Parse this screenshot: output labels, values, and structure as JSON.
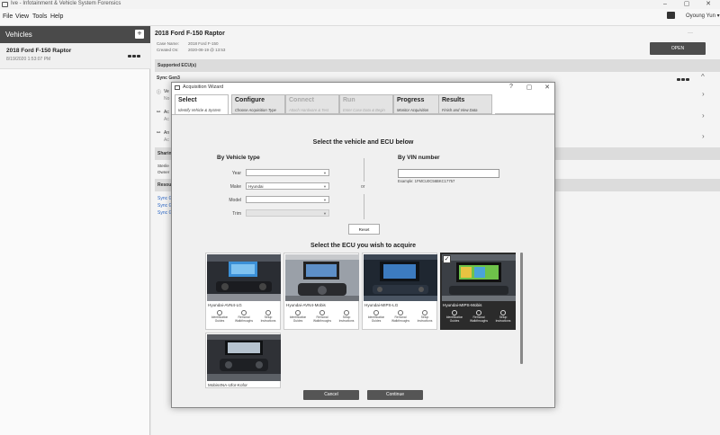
{
  "window": {
    "title": "Ive - Infotainment & Vehicle System Forensics",
    "controls": [
      "–",
      "▢",
      "✕"
    ]
  },
  "menu": {
    "items": [
      "File",
      "View",
      "Tools",
      "Help"
    ],
    "user": "Oyoung Yun ▾"
  },
  "sidebar": {
    "title": "Vehicles",
    "add_label": "+",
    "vehicle": {
      "name": "2018 Ford F-150 Raptor",
      "date": "8/19/2020 1:53:07 PM"
    }
  },
  "case": {
    "title": "2018 Ford F-150 Raptor",
    "name_label": "Case Name:",
    "name_value": "2018 Ford F-150",
    "created_label": "Created On:",
    "created_value": "2020-08-19 @ 13:53",
    "open_label": "OPEN",
    "more_label": "···",
    "supported_label": "Supported ECU(s)",
    "sync_label": "Sync Gen3",
    "rows": [
      {
        "icon": "ⓘ",
        "title": "Ve",
        "sub": "No"
      },
      {
        "icon": "⚯",
        "title": "Ac",
        "sub": "Ac"
      },
      {
        "icon": "⚯",
        "title": "An",
        "sub": "Ac"
      }
    ],
    "sharing_label": "Sharing",
    "sharing_lines": [
      "Sterile",
      "Owner"
    ],
    "resources_label": "Resources",
    "resource_links": [
      "Sync G",
      "Sync G",
      "Sync G"
    ]
  },
  "dialog": {
    "title": "Acquisition Wizard",
    "controls": [
      "?",
      "▢",
      "✕"
    ],
    "tabs": [
      {
        "title": "Select",
        "sub": "Identify Vehicle & System",
        "state": "active"
      },
      {
        "title": "Configure",
        "sub": "Choose Acquisition Type",
        "state": "normal"
      },
      {
        "title": "Connect",
        "sub": "Attach Hardware & Test",
        "state": "disabled"
      },
      {
        "title": "Run",
        "sub": "Enter Case Data & Begin",
        "state": "disabled"
      },
      {
        "title": "Progress",
        "sub": "Monitor Acquisition",
        "state": "normal"
      },
      {
        "title": "Results",
        "sub": "Finish and View Data",
        "state": "normal"
      }
    ],
    "heading_vehicle": "Select the vehicle and ECU below",
    "by_type": "By Vehicle type",
    "by_vin": "By VIN number",
    "fields": [
      {
        "label": "Year",
        "value": "",
        "disabled": false
      },
      {
        "label": "Make",
        "value": "Hyundai",
        "disabled": false
      },
      {
        "label": "Model",
        "value": "",
        "disabled": false
      },
      {
        "label": "Trim",
        "value": "",
        "disabled": true
      }
    ],
    "or_label": "or",
    "vin_value": "",
    "vin_example": "Example: 1FMCU0C56BKC17757",
    "reset_label": "Reset",
    "heading_ecu": "Select the ECU you wish to acquire",
    "ecus": [
      {
        "name": "Hyundai-AVN4-LG",
        "selected": false
      },
      {
        "name": "Hyundai-AVN4-Mobis",
        "selected": false
      },
      {
        "name": "Hyundai-MIPS-LG",
        "selected": false
      },
      {
        "name": "Hyundai-MIPS-Mobis",
        "selected": true
      },
      {
        "name": "Mobis4NA-Ufor-Kofor",
        "selected": false
      }
    ],
    "ecu_actions": [
      {
        "icon": "identification-icon",
        "label": "Identification Guides"
      },
      {
        "icon": "removal-icon",
        "label": "Removal Walkthroughs"
      },
      {
        "icon": "setup-icon",
        "label": "Setup Instructions"
      }
    ],
    "cancel_label": "Cancel",
    "continue_label": "Continue"
  }
}
